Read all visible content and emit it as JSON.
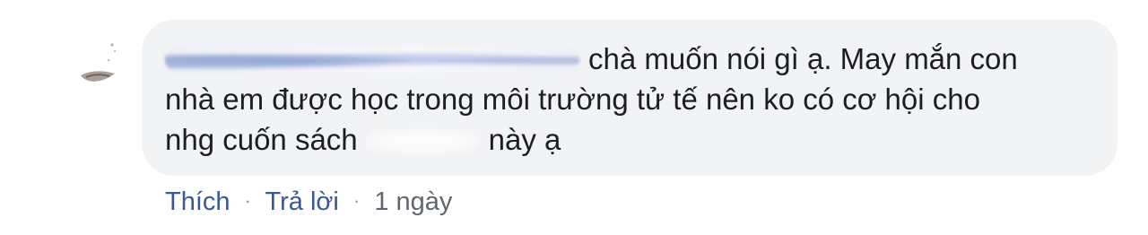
{
  "comment": {
    "text_line1": "chà muốn nói gì ạ. May mắn con",
    "text_line2": "nhà em được học trong môi trường tử tế nên ko có cơ hội cho",
    "text_line3_before": "nhg cuốn sách",
    "text_line3_after": "này ạ"
  },
  "actions": {
    "like_label": "Thích",
    "separator": "·",
    "reply_label": "Trả lời",
    "timestamp": "1 ngày"
  },
  "colors": {
    "bubble_bg": "#f2f3f5",
    "link": "#385898",
    "text": "#1c1e21",
    "meta": "#606770"
  }
}
